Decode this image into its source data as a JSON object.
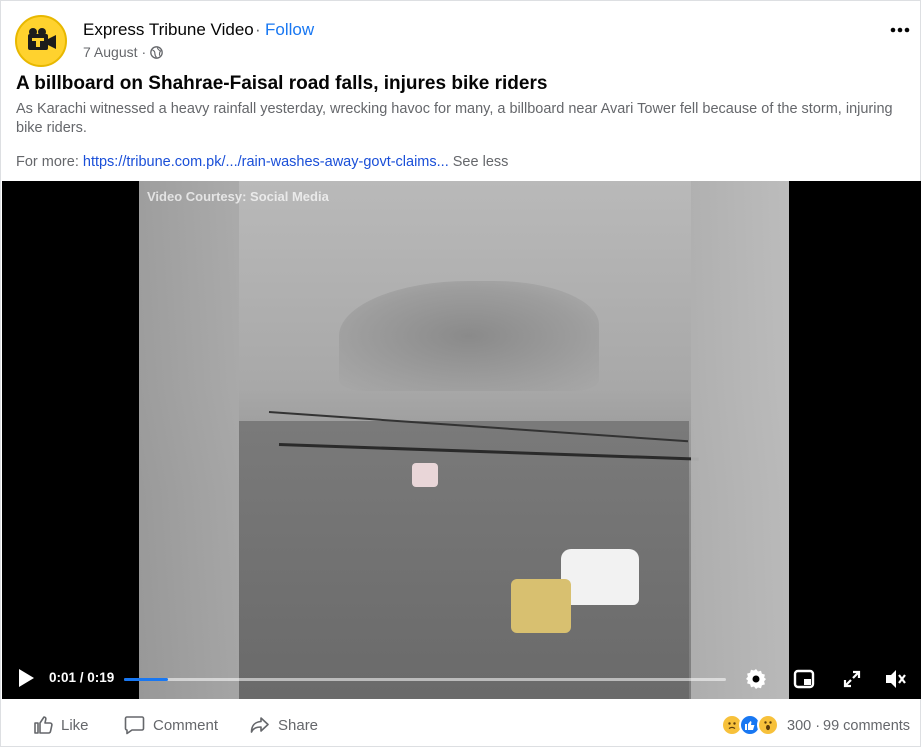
{
  "header": {
    "page_name": "Express Tribune Video",
    "separator": "·",
    "follow_label": "Follow",
    "date": "7 August",
    "date_separator": "·"
  },
  "post": {
    "title": "A billboard on Shahrae-Faisal road falls, injures bike riders",
    "body": "As Karachi witnessed a heavy rainfall yesterday, wrecking havoc for many, a billboard near Avari Tower fell because of the storm, injuring bike riders.",
    "more_prefix": "For more: ",
    "link_text": "https://tribune.com.pk/.../rain-washes-away-govt-claims...",
    "see_less": "See less"
  },
  "video": {
    "watermark": "Video Courtesy: Social Media",
    "current_time": "0:01",
    "duration": "0:19",
    "time_display": "0:01 / 0:19",
    "progress_percent": 7.3
  },
  "footer": {
    "like_label": "Like",
    "comment_label": "Comment",
    "share_label": "Share",
    "reaction_count": "300",
    "dot": "·",
    "comments_count": "99 comments"
  },
  "colors": {
    "accent": "#1877f2",
    "link": "#1a4fd8",
    "secondary_text": "#65676b",
    "avatar_bg": "#ffd22e"
  },
  "icons": [
    "camera-logo-icon",
    "globe-icon",
    "more-options-icon",
    "play-icon",
    "settings-icon",
    "picture-in-picture-icon",
    "fullscreen-icon",
    "mute-icon",
    "like-icon",
    "comment-icon",
    "share-icon",
    "sad-reaction-icon",
    "like-reaction-icon",
    "wow-reaction-icon"
  ]
}
